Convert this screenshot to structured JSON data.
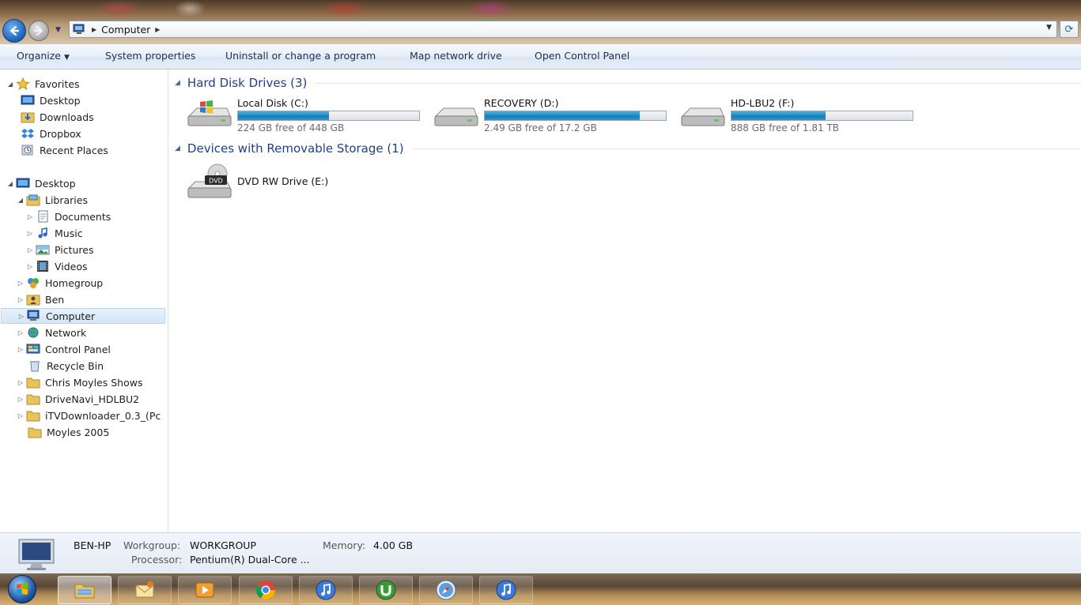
{
  "window": {
    "address": {
      "location": "Computer"
    }
  },
  "commandbar": {
    "organize": "Organize",
    "system_properties": "System properties",
    "uninstall": "Uninstall or change a program",
    "map_drive": "Map network drive",
    "control_panel": "Open Control Panel"
  },
  "navpane": {
    "favorites": {
      "label": "Favorites",
      "items": [
        "Desktop",
        "Downloads",
        "Dropbox",
        "Recent Places"
      ]
    },
    "desktop": "Desktop",
    "libraries": "Libraries",
    "library_items": [
      "Documents",
      "Music",
      "Pictures",
      "Videos"
    ],
    "items": [
      "Homegroup",
      "Ben",
      "Computer",
      "Network",
      "Control Panel",
      "Recycle Bin",
      "Chris Moyles Shows",
      "DriveNavi_HDLBU2",
      "iTVDownloader_0.3_(Pc",
      "Moyles 2005"
    ],
    "selected": "Computer"
  },
  "content": {
    "hdd_group": "Hard Disk Drives (3)",
    "drives": [
      {
        "name": "Local Disk (C:)",
        "free": "224 GB free of 448 GB",
        "used_fraction": 0.5
      },
      {
        "name": "RECOVERY (D:)",
        "free": "2.49 GB free of 17.2 GB",
        "used_fraction": 0.855
      },
      {
        "name": "HD-LBU2 (F:)",
        "free": "888 GB free of 1.81 TB",
        "used_fraction": 0.52
      }
    ],
    "removable_group": "Devices with Removable Storage (1)",
    "removable": [
      {
        "name": "DVD RW Drive (E:)",
        "icon_text": "DVD"
      }
    ]
  },
  "details": {
    "computer_name": "BEN-HP",
    "workgroup_label": "Workgroup:",
    "workgroup": "WORKGROUP",
    "memory_label": "Memory:",
    "memory": "4.00 GB",
    "processor_label": "Processor:",
    "processor": "Pentium(R) Dual-Core ..."
  },
  "taskbar": {
    "items": [
      "explorer-icon",
      "mail-icon",
      "media-player-icon",
      "chrome-icon",
      "itunes-icon",
      "utorrent-icon",
      "safari-icon",
      "itunes-icon"
    ]
  },
  "colors": {
    "group_header": "#1e3f8a",
    "drive_bar": "#1e89c2",
    "selection": "#d3e6f8"
  }
}
